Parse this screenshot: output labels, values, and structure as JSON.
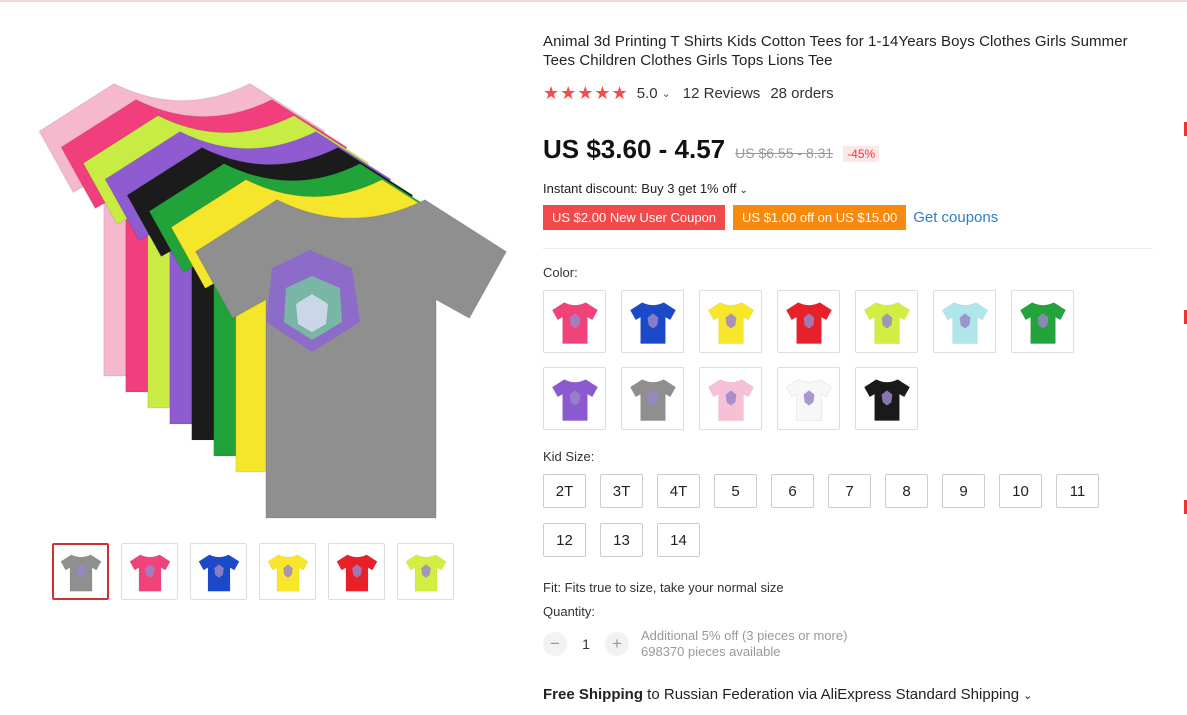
{
  "product": {
    "title": "Animal 3d Printing T Shirts Kids Cotton Tees for 1-14Years Boys Clothes Girls Summer Tees Children Clothes Girls Tops Lions Tee"
  },
  "rating": {
    "stars": "★★★★★",
    "score": "5.0",
    "chevron": "⌄",
    "reviews": "12 Reviews",
    "orders": "28 orders"
  },
  "price": {
    "current": "US $3.60 - 4.57",
    "original": "US $6.55 - 8.31",
    "discount": "-45%"
  },
  "instant_discount": {
    "text": "Instant discount: Buy 3 get 1% off",
    "chevron": "⌄"
  },
  "coupons": {
    "new_user": "US $2.00 New User Coupon",
    "store": "US $1.00 off on US $15.00",
    "get_label": "Get coupons"
  },
  "color": {
    "label": "Color:",
    "options": [
      "#f0437a",
      "#1b49c9",
      "#f7e62a",
      "#e8202a",
      "#d2ee43",
      "#aee6ea",
      "#24a23b",
      "#8c5ad0",
      "#8f8f8f",
      "#f6c0d6",
      "#f7f7f7",
      "#1a1a1a"
    ]
  },
  "size": {
    "label": "Kid Size:",
    "options": [
      "2T",
      "3T",
      "4T",
      "5",
      "6",
      "7",
      "8",
      "9",
      "10",
      "11",
      "12",
      "13",
      "14"
    ]
  },
  "fit": "Fit: Fits true to size, take your normal size",
  "quantity": {
    "label": "Quantity:",
    "minus": "−",
    "value": "1",
    "plus": "+",
    "bulk_note": "Additional 5% off (3 pieces or more)",
    "available": "698370 pieces available"
  },
  "shipping": {
    "bold": "Free Shipping",
    "rest": " to Russian Federation via AliExpress Standard Shipping",
    "chevron": "⌄"
  },
  "gallery": {
    "stack_colors": [
      "#f6b8cc",
      "#f03f7c",
      "#c9ec45",
      "#8e5bd1",
      "#1b1b1b",
      "#22a33a",
      "#f5e62b",
      "#8f8f8f"
    ],
    "thumbs": [
      "#8f8f8f",
      "#f0437a",
      "#1b49c9",
      "#f7e62a",
      "#e8202a",
      "#d2ee43"
    ]
  },
  "colors_ui": {
    "accent_red": "#f24a4a",
    "accent_orange": "#f7890c",
    "link_blue": "#2f7fc8",
    "star_red": "#f44b4b"
  }
}
